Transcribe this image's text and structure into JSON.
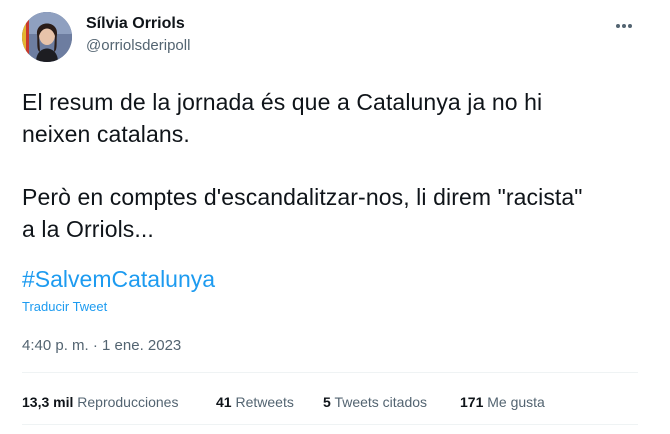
{
  "author": {
    "name": "Sílvia Orriols",
    "handle": "@orriolsderipoll"
  },
  "tweet": {
    "lines": [
      "El resum de la jornada és que a Catalunya ja no hi",
      "neixen catalans.",
      "Però en comptes d'escandalitzar-nos, li direm \"racista\"",
      "a la Orriols..."
    ],
    "hashtag": "#SalvemCatalunya",
    "translate_label": "Traducir Tweet",
    "timestamp": "4:40 p. m. · 1 ene. 2023"
  },
  "stats": {
    "views_count": "13,3 mil",
    "views_label": "Reproducciones",
    "retweets_count": "41",
    "retweets_label": "Retweets",
    "quotes_count": "5",
    "quotes_label": "Tweets citados",
    "likes_count": "171",
    "likes_label": "Me gusta"
  },
  "icons": {
    "more": "more-horizontal-icon",
    "avatar": "profile-photo"
  },
  "colors": {
    "text": "#0f1419",
    "secondary": "#536471",
    "link": "#1d9bf0"
  }
}
